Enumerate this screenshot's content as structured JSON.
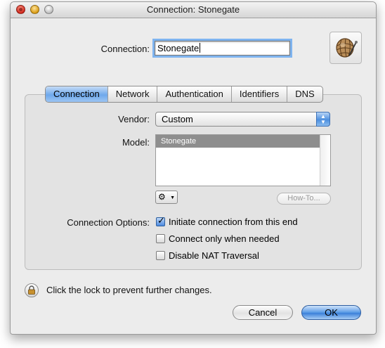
{
  "window": {
    "title": "Connection: Stonegate"
  },
  "connection": {
    "label": "Connection:",
    "value": "Stonegate"
  },
  "tabs": [
    {
      "label": "Connection",
      "selected": true
    },
    {
      "label": "Network",
      "selected": false
    },
    {
      "label": "Authentication",
      "selected": false
    },
    {
      "label": "Identifiers",
      "selected": false
    },
    {
      "label": "DNS",
      "selected": false
    }
  ],
  "vendor": {
    "label": "Vendor:",
    "selected": "Custom"
  },
  "model": {
    "label": "Model:",
    "items": [
      "Stonegate"
    ],
    "selected_index": 0
  },
  "actions": {
    "gear_icon": "gear-icon",
    "howto_label": "How-To..."
  },
  "options": {
    "label": "Connection Options:",
    "checkboxes": [
      {
        "label": "Initiate connection from this end",
        "checked": true
      },
      {
        "label": "Connect only when needed",
        "checked": false
      },
      {
        "label": "Disable NAT Traversal",
        "checked": false
      }
    ]
  },
  "lock": {
    "text": "Click the lock to prevent further changes."
  },
  "buttons": {
    "cancel": "Cancel",
    "ok": "OK"
  },
  "colors": {
    "accent": "#6ea8ec",
    "window_bg": "#ececec"
  }
}
